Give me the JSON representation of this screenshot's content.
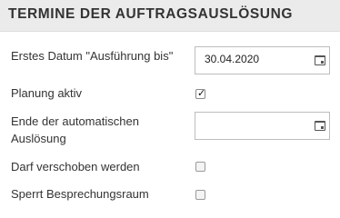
{
  "section": {
    "title": "TERMINE DER AUFTRAGSAUSLÖSUNG"
  },
  "fields": {
    "erstes_datum": {
      "label": "Erstes Datum \"Ausführung bis\"",
      "value": "30.04.2020",
      "icon": "calendar-icon"
    },
    "planung_aktiv": {
      "label": "Planung aktiv",
      "checked": true
    },
    "ende_ausloesung": {
      "label_line1": "Ende der automatischen",
      "label_line2": "Auslösung",
      "value": "",
      "icon": "calendar-icon"
    },
    "darf_verschoben": {
      "label": "Darf verschoben werden",
      "checked": false
    },
    "sperrt_raum": {
      "label": "Sperrt Besprechungsraum",
      "checked": false
    }
  }
}
